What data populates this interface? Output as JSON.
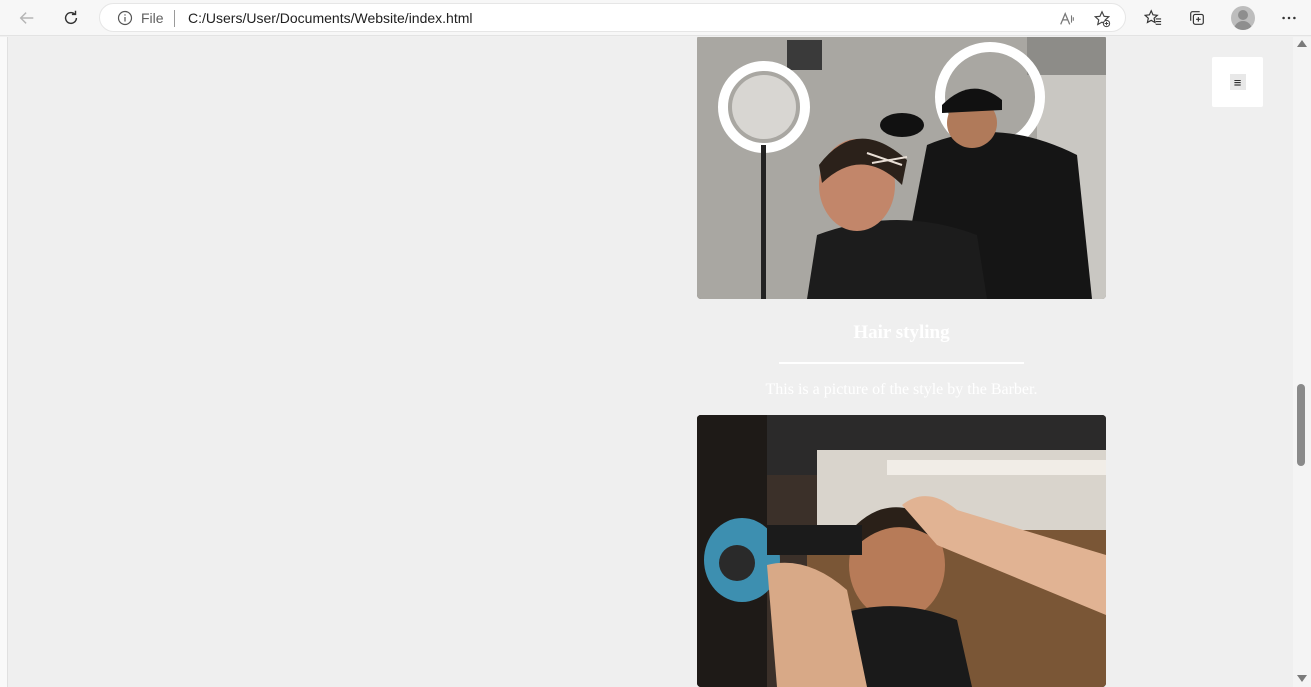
{
  "browser": {
    "address_scheme_label": "File",
    "url": "C:/Users/User/Documents/Website/index.html",
    "icons": {
      "back": "back-arrow-icon",
      "refresh": "refresh-icon",
      "info": "info-icon",
      "read_aloud": "read-aloud-icon",
      "add_favorite": "add-favorite-icon",
      "favorites": "favorites-icon",
      "collections": "collections-icon",
      "profile": "profile-avatar-icon",
      "more": "more-menu-icon"
    }
  },
  "page": {
    "background": "#efefef",
    "menu_button_glyph": "≡",
    "cards": [
      {
        "image": "barber-hair-design-photo"
      },
      {
        "title": "Hair styling",
        "description": "This is a picture of the style by the Barber.",
        "image": "barber-blow-dry-photo"
      }
    ],
    "scroll_position_fraction": 0.55
  }
}
